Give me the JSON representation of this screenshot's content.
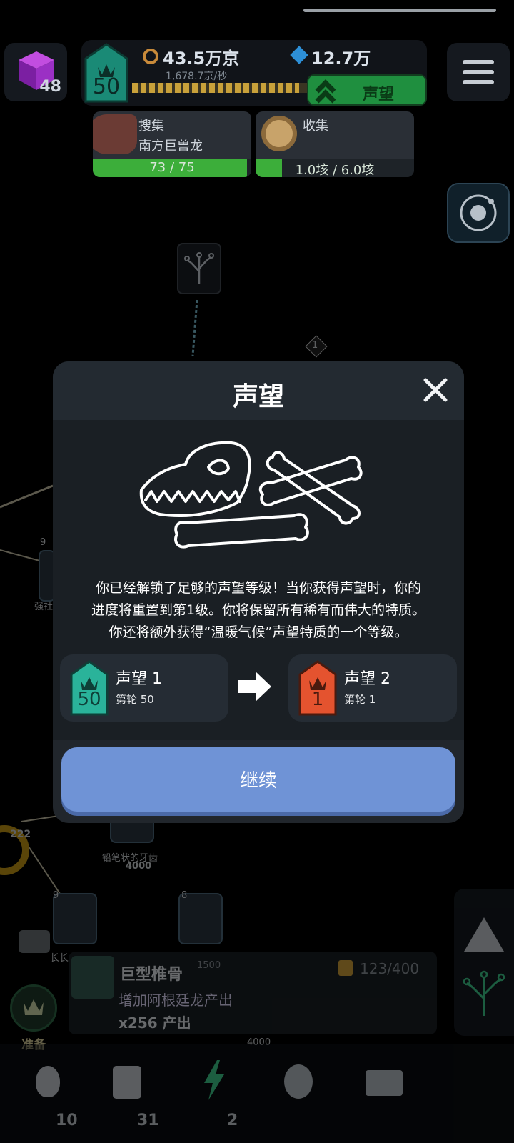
{
  "hud": {
    "cube_count": "48",
    "level": "50",
    "amber_amount": "43.5万京",
    "amber_rate": "1,678.7京/秒",
    "gem_amount": "12.7万",
    "prestige_button": "声望",
    "progress": 0.9
  },
  "tasks": [
    {
      "title": "搜集",
      "subtitle": "南方巨兽龙",
      "bar_text": "73 / 75",
      "progress": 0.973
    },
    {
      "title": "收集",
      "subtitle": "",
      "bar_text": "1.0垓 / 6.0垓",
      "progress": 0.167
    }
  ],
  "tree": {
    "node_badges": [
      "1",
      "9",
      "9",
      "8"
    ],
    "numbers": [
      "222"
    ],
    "labels": {
      "strong": "强社",
      "pencil_teeth": "铅笔状的牙齿",
      "pencil_teeth_cost": "4000",
      "long": "长长",
      "cost_4000": "4000",
      "cost_1500": "1500"
    }
  },
  "modal": {
    "title": "声望",
    "description_lines": [
      "你已经解锁了足够的声望等级！当你获得声望时，你的",
      "进度将重置到第1级。你将保留所有稀有而伟大的特质。",
      "你还将额外获得“温暖气候”声望特质的一个等级。"
    ],
    "from": {
      "badge": "50",
      "title": "声望 1",
      "sub": "第轮 50"
    },
    "to": {
      "badge": "1",
      "title": "声望 2",
      "sub": "第轮 1"
    },
    "continue": "继续"
  },
  "quest": {
    "title": "巨型椎骨",
    "description": "增加阿根廷龙产出",
    "multiplier": "x256 产出",
    "count": "123/400"
  },
  "left_panel": {
    "ready_label": "准备"
  },
  "nav": [
    {
      "name": "eggs",
      "count": "10"
    },
    {
      "name": "cards",
      "count": "31"
    },
    {
      "name": "power",
      "count": "2"
    },
    {
      "name": "badge",
      "count": ""
    },
    {
      "name": "book",
      "count": ""
    }
  ],
  "colors": {
    "background": "#000000",
    "modal": "#21262c",
    "continue_button": "#6f93d6",
    "current_badge": "#2ab39a",
    "next_badge": "#e4532f",
    "prestige_green": "#1f8f3f"
  }
}
